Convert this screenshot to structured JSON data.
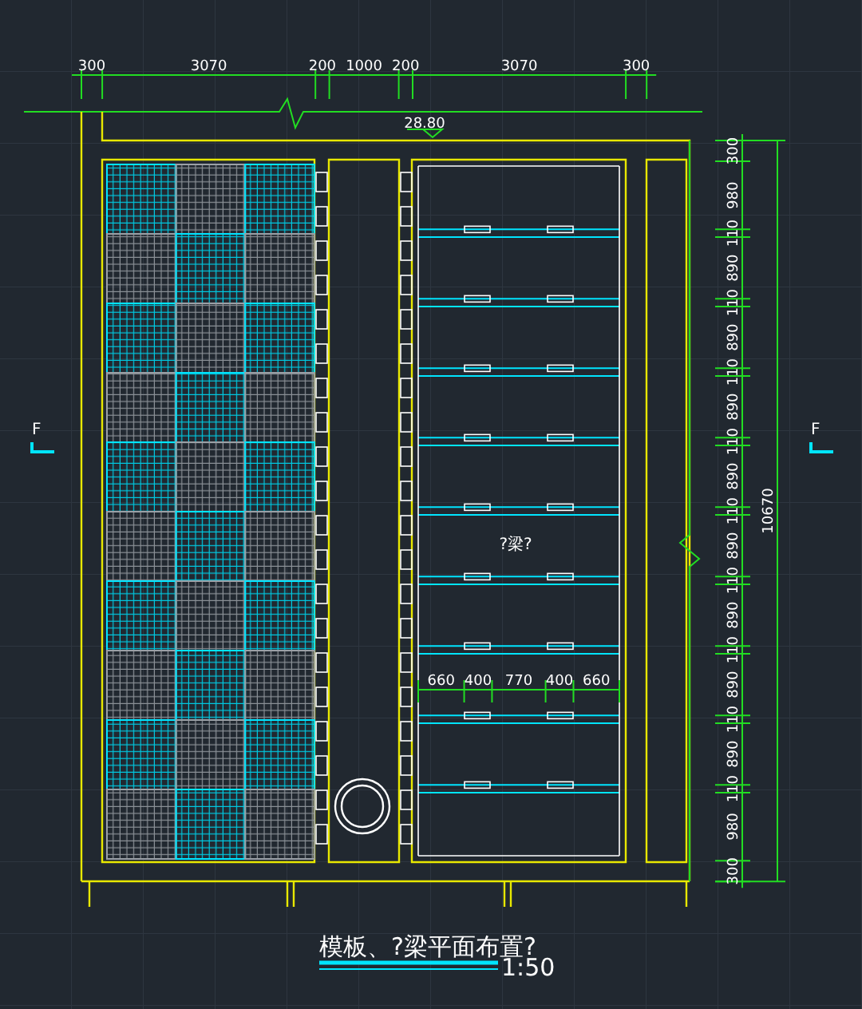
{
  "top_dimensions": [
    "300",
    "3070",
    "200",
    "1000",
    "200",
    "3070",
    "300"
  ],
  "level_mark": "28.80",
  "section_marks": [
    {
      "label": "F"
    },
    {
      "label": "F"
    }
  ],
  "right_dimensions": [
    "300",
    "980",
    "110",
    "890",
    "110",
    "890",
    "110",
    "890",
    "110",
    "890",
    "110",
    "890",
    "110",
    "890",
    "110",
    "890",
    "110",
    "890",
    "110",
    "980",
    "300"
  ],
  "overall_dimension": "10670",
  "beam_dimensions": [
    "660",
    "400",
    "770",
    "400",
    "660"
  ],
  "room_label": "?梁?",
  "title": "模板、?梁平面布置?",
  "scale": "1:50"
}
